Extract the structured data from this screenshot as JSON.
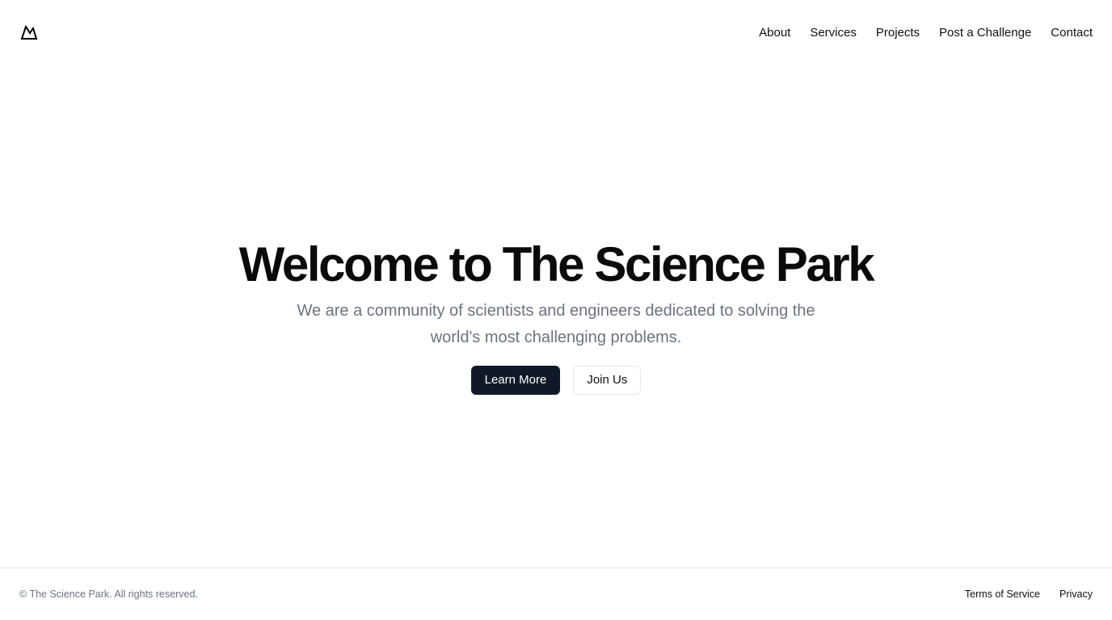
{
  "header": {
    "logo_icon": "mountain-icon",
    "nav": [
      {
        "label": "About"
      },
      {
        "label": "Services"
      },
      {
        "label": "Projects"
      },
      {
        "label": "Post a Challenge"
      },
      {
        "label": "Contact"
      }
    ]
  },
  "hero": {
    "title": "Welcome to The Science Park",
    "subtitle": "We are a community of scientists and engineers dedicated to solving the world's most challenging problems.",
    "primary_button": "Learn More",
    "secondary_button": "Join Us"
  },
  "footer": {
    "copyright": "© The Science Park. All rights reserved.",
    "links": [
      {
        "label": "Terms of Service"
      },
      {
        "label": "Privacy"
      }
    ]
  },
  "colors": {
    "background": "#ffffff",
    "primary_button_bg": "#111827",
    "muted_text": "#6b7280",
    "border": "#e5e7eb"
  }
}
